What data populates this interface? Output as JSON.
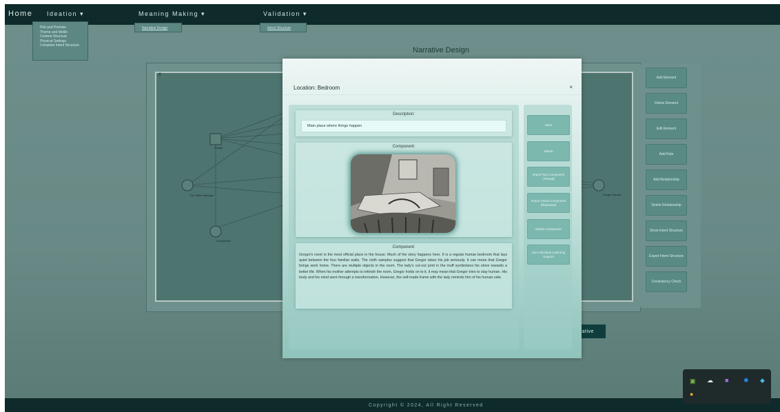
{
  "nav": {
    "home": "Home",
    "ideation": "Ideation ▾",
    "meaning": "Meaning Making ▾",
    "validation": "Validation ▾",
    "ideation_items": [
      "Plot and Premise",
      "Theme and Motifs",
      "Content Structure",
      "Physical Settings",
      "Complete Intent Structure"
    ],
    "meaning_items": [
      "Narrative Design"
    ],
    "validation_items": [
      "Intent Structure"
    ]
  },
  "page_title": "Narrative Design",
  "canvas": {
    "hash": "#",
    "node_labels": [
      "Gregor",
      "The Office Manager",
      "Composition",
      "Gregor Samsa"
    ]
  },
  "right_panel": {
    "buttons": [
      "Add Element",
      "Delete Element",
      "Edit Element",
      "Add Rule",
      "Add Relationship",
      "Delete Relationship",
      "Show Intent Structure",
      "Export Intent Structure",
      "Consistency Check"
    ]
  },
  "narrative_button": "rrative",
  "modal": {
    "title": "Location: Bedroom",
    "close": "×",
    "description_label": "Description:",
    "description_value": "Main place where things happen",
    "component_label_1": "Component:",
    "component_label_2": "Component:",
    "component_text": "Gregor's room is the most official place in the house. Much of the story happens here. It is a regular human bedroom that lays quiet between the four familiar walls. The cloth samples suggest that Gregor takes his job seriously. It can mean that Gregor brings work home. There are multiple objects in the room. The lady's cut-out print in the muff symbolizes his strive towards a better life. When his mother attempts to refinish the room, Gregor holds on to it, it may mean that Gregor tries to stay human. His body and his mind went through a transformation. However, the self-made frame with the lady reminds him of his human side.",
    "side_buttons": [
      "Save",
      "Delete",
      "Import Text Component (Textual)",
      "Import Visual Component (Illustrated)",
      "Delete Component",
      "Use Individual Authoring Support"
    ]
  },
  "footer": "Copyright © 2024, All Right Reserved",
  "colors": {
    "nav_bg": "#0e2a2a",
    "accent": "#0f3d3d",
    "modal_button": "#7db8af"
  }
}
